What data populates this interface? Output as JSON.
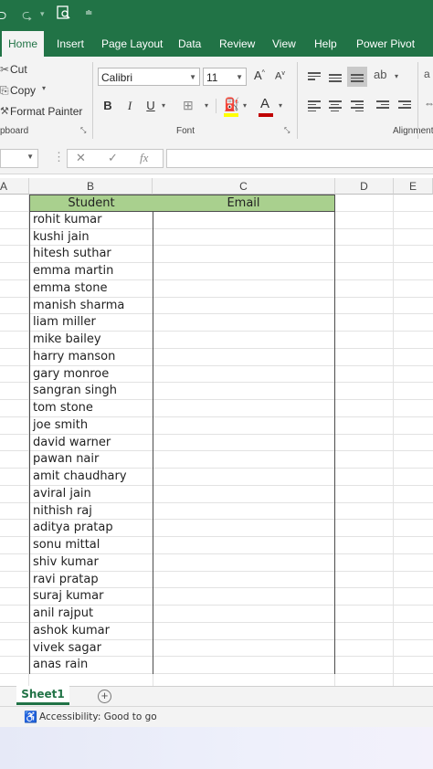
{
  "ribbon_tabs": [
    "Home",
    "Insert",
    "Page Layout",
    "Data",
    "Review",
    "View",
    "Help",
    "Power Pivot"
  ],
  "active_tab": "Home",
  "clipboard": {
    "cut": "Cut",
    "copy": "Copy",
    "format_painter": "Format Painter",
    "group_label": "pboard"
  },
  "font": {
    "name": "Calibri",
    "size": "11",
    "group_label": "Font",
    "bold": "B",
    "italic": "I",
    "underline": "U"
  },
  "alignment": {
    "group_label": "Alignment"
  },
  "formula_bar": {
    "fx": "fx",
    "value": ""
  },
  "columns": [
    "A",
    "B",
    "C",
    "D",
    "E"
  ],
  "table": {
    "headers": [
      "Student",
      "Email"
    ],
    "rows": [
      "rohit kumar",
      "kushi jain",
      "hitesh suthar",
      "emma martin",
      "emma stone",
      "manish sharma",
      "liam miller",
      "mike bailey",
      "harry manson",
      "gary monroe",
      "sangran singh",
      "tom stone",
      "joe smith",
      "david warner",
      "pawan nair",
      "amit chaudhary",
      "aviral jain",
      "nithish raj",
      "aditya pratap",
      "sonu mittal",
      "shiv kumar",
      "ravi pratap",
      "suraj kumar",
      "anil rajput",
      "ashok kumar",
      "vivek sagar",
      "anas rain"
    ]
  },
  "sheet": {
    "tab": "Sheet1",
    "add": "+"
  },
  "status": {
    "accessibility": "Accessibility: Good to go"
  },
  "colors": {
    "brand": "#217346",
    "header_fill": "#a9d08e",
    "font_red": "#c00000",
    "highlight_yellow": "#ffff00"
  }
}
